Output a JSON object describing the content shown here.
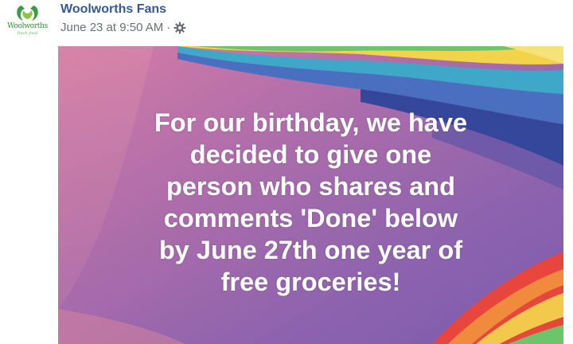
{
  "post": {
    "page_name": "Woolworths Fans",
    "timestamp": "June 23 at 9:50 AM",
    "separator": "·",
    "privacy_icon": "gear-icon",
    "avatar": {
      "logo_text": "Woolworths",
      "tagline": "fresh food",
      "icon": "woolworths-logo-icon",
      "brand_color": "#2f8f3a"
    },
    "image": {
      "lines": [
        "For our birthday, we have",
        "decided to give one",
        "person who shares and",
        "comments 'Done' below",
        "by June 27th one year of",
        "free groceries!"
      ],
      "text_color": "#ffffff",
      "background_colors": [
        "#d67ca6",
        "#9a68b0",
        "#7a5ab0",
        "#3b4f9a",
        "#3fa8c8",
        "#6cc56a",
        "#f2d34a",
        "#f08a3c",
        "#e8463c"
      ]
    }
  }
}
